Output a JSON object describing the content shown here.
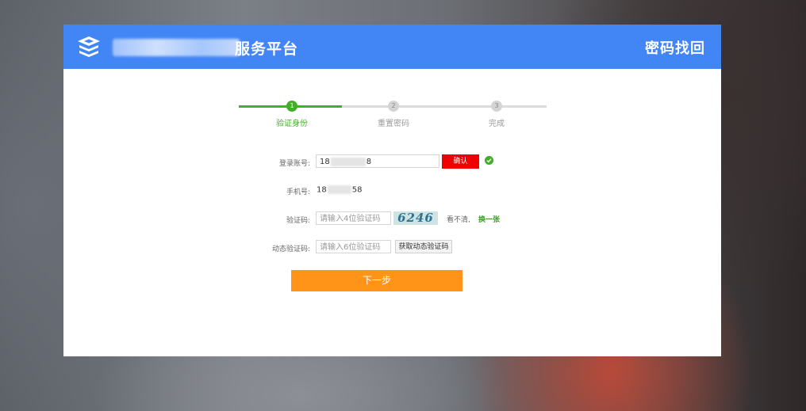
{
  "header": {
    "site_title": "服务平台",
    "page_title": "密码找回"
  },
  "steps": [
    {
      "num": "1",
      "label": "验证身份",
      "state": "active"
    },
    {
      "num": "2",
      "label": "重置密码",
      "state": "pending"
    },
    {
      "num": "3",
      "label": "完成",
      "state": "pending"
    }
  ],
  "form": {
    "account_label": "登录账号:",
    "account_prefix": "18",
    "account_suffix": "8",
    "confirm_label": "确认",
    "phone_label": "手机号:",
    "phone_prefix": "18",
    "phone_suffix": "58",
    "captcha_label": "验证码:",
    "captcha_placeholder": "请输入4位验证码",
    "captcha_text": "6246",
    "unclear_text": "看不清,",
    "refresh_label": "换一张",
    "sms_label": "动态验证码:",
    "sms_placeholder": "请输入6位验证码",
    "get_code_label": "获取动态验证码",
    "next_label": "下一步"
  },
  "colors": {
    "header": "#4285f4",
    "step_active": "#41b028",
    "confirm": "#f00000",
    "next": "#ff9418"
  }
}
